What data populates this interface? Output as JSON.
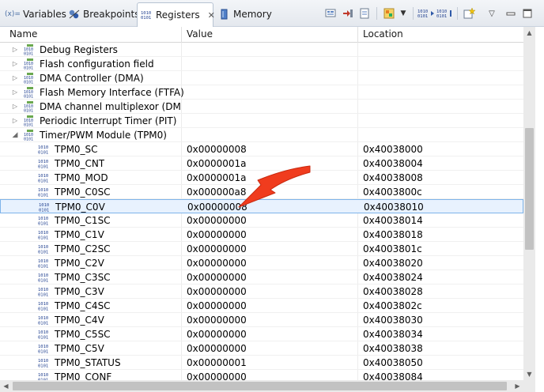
{
  "tabs": [
    {
      "label": "Variables",
      "icon": "variables-icon",
      "prefix": "(x)="
    },
    {
      "label": "Breakpoints",
      "icon": "breakpoints-icon"
    },
    {
      "label": "Registers",
      "icon": "registers-icon",
      "active": true
    },
    {
      "label": "Memory",
      "icon": "memory-icon"
    }
  ],
  "toolbar": {
    "icons": [
      "refresh-registers-icon",
      "add-register-group-icon",
      "remove-register-group-icon",
      "restore-default-groups-icon",
      "dropdown-chevron-icon",
      "number-format-icon",
      "number-format-toggle-icon",
      "new-view-icon",
      "view-menu-icon",
      "minimize-icon",
      "maximize-icon"
    ]
  },
  "columns": {
    "name": "Name",
    "value": "Value",
    "location": "Location"
  },
  "groups": [
    {
      "label": "Debug Registers",
      "expanded": false
    },
    {
      "label": "Flash configuration field",
      "expanded": false
    },
    {
      "label": "DMA Controller (DMA)",
      "expanded": false
    },
    {
      "label": "Flash Memory Interface (FTFA)",
      "expanded": false
    },
    {
      "label": "DMA channel multiplexor (DMAM",
      "expanded": false
    },
    {
      "label": "Periodic Interrupt Timer (PIT)",
      "expanded": false
    },
    {
      "label": "Timer/PWM Module (TPM0)",
      "expanded": true
    }
  ],
  "registers": [
    {
      "name": "TPM0_SC",
      "value": "0x00000008",
      "location": "0x40038000"
    },
    {
      "name": "TPM0_CNT",
      "value": "0x0000001a",
      "location": "0x40038004"
    },
    {
      "name": "TPM0_MOD",
      "value": "0x0000001a",
      "location": "0x40038008"
    },
    {
      "name": "TPM0_C0SC",
      "value": "0x000000a8",
      "location": "0x4003800c"
    },
    {
      "name": "TPM0_C0V",
      "value": "0x00000008",
      "location": "0x40038010",
      "selected": true
    },
    {
      "name": "TPM0_C1SC",
      "value": "0x00000000",
      "location": "0x40038014"
    },
    {
      "name": "TPM0_C1V",
      "value": "0x00000000",
      "location": "0x40038018"
    },
    {
      "name": "TPM0_C2SC",
      "value": "0x00000000",
      "location": "0x4003801c"
    },
    {
      "name": "TPM0_C2V",
      "value": "0x00000000",
      "location": "0x40038020"
    },
    {
      "name": "TPM0_C3SC",
      "value": "0x00000000",
      "location": "0x40038024"
    },
    {
      "name": "TPM0_C3V",
      "value": "0x00000000",
      "location": "0x40038028"
    },
    {
      "name": "TPM0_C4SC",
      "value": "0x00000000",
      "location": "0x4003802c"
    },
    {
      "name": "TPM0_C4V",
      "value": "0x00000000",
      "location": "0x40038030"
    },
    {
      "name": "TPM0_C5SC",
      "value": "0x00000000",
      "location": "0x40038034"
    },
    {
      "name": "TPM0_C5V",
      "value": "0x00000000",
      "location": "0x40038038"
    },
    {
      "name": "TPM0_STATUS",
      "value": "0x00000001",
      "location": "0x40038050"
    },
    {
      "name": "TPM0_CONF",
      "value": "0x00000000",
      "location": "0x40038084"
    }
  ],
  "colors": {
    "selection_bg": "#e8f2fe",
    "selection_border": "#7eb4ea",
    "annotation_arrow": "#f03c1e",
    "register_icon": "#1f3f8f"
  }
}
